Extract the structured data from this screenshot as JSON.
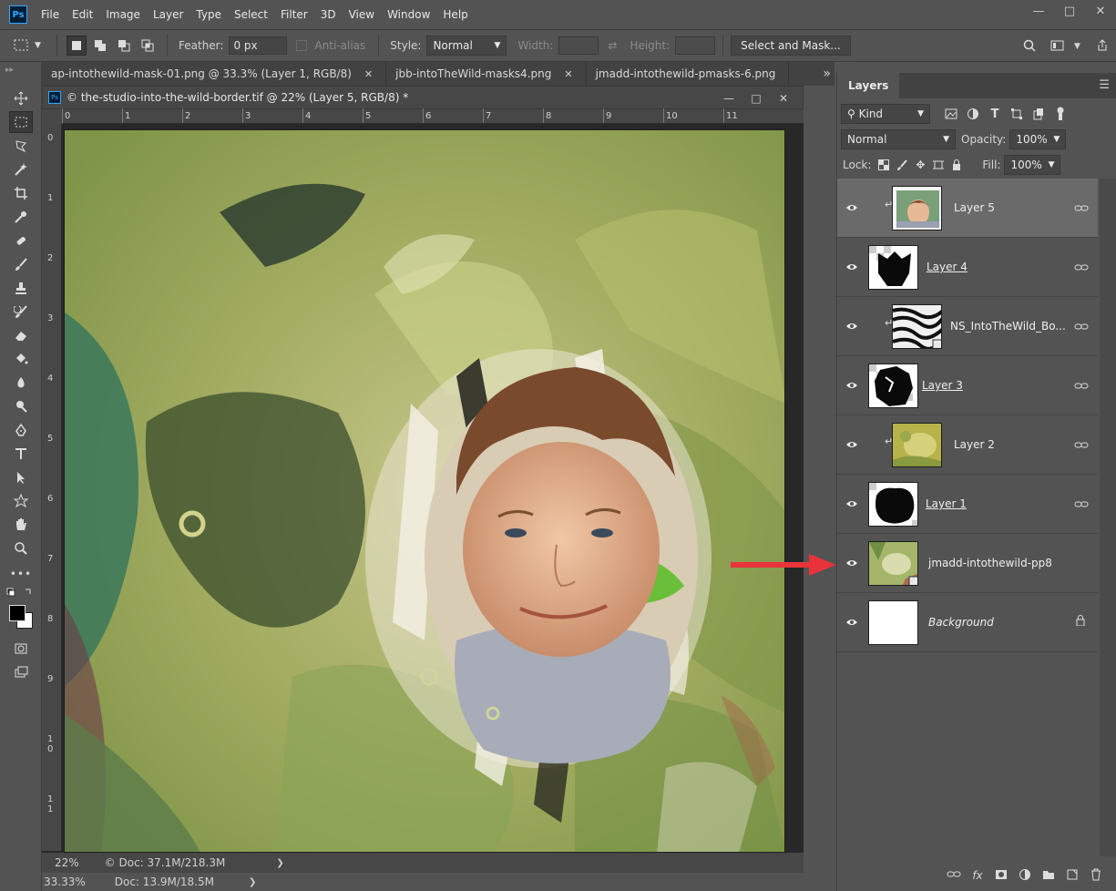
{
  "app": {
    "menu": [
      "File",
      "Edit",
      "Image",
      "Layer",
      "Type",
      "Select",
      "Filter",
      "3D",
      "View",
      "Window",
      "Help"
    ],
    "logo_text": "Ps"
  },
  "options": {
    "feather_label": "Feather:",
    "feather_value": "0 px",
    "antialias_label": "Anti-alias",
    "style_label": "Style:",
    "style_value": "Normal",
    "width_label": "Width:",
    "height_label": "Height:",
    "select_mask_label": "Select and Mask..."
  },
  "tabs": [
    {
      "label": "ap-intothewild-mask-01.png @ 33.3% (Layer 1, RGB/8)"
    },
    {
      "label": "jbb-intoTheWild-masks4.png"
    },
    {
      "label": "jmadd-intothewild-pmasks-6.png"
    }
  ],
  "document": {
    "title": "© the-studio-into-the-wild-border.tif @ 22% (Layer 5, RGB/8) *",
    "ruler_top": [
      "0",
      "1",
      "2",
      "3",
      "4",
      "5",
      "6",
      "7",
      "8",
      "9",
      "10",
      "11"
    ],
    "ruler_left": [
      "0",
      "1",
      "2",
      "3",
      "4",
      "5",
      "6",
      "7",
      "8",
      "9",
      "10",
      "11"
    ],
    "status_zoom": "22%",
    "status_doc": "© Doc: 37.1M/218.3M"
  },
  "app_status": {
    "zoom": "33.33%",
    "doc": "Doc: 13.9M/18.5M"
  },
  "layers_panel": {
    "title": "Layers",
    "filter_kind": "Kind",
    "blend_mode": "Normal",
    "opacity_label": "Opacity:",
    "opacity_value": "100%",
    "lock_label": "Lock:",
    "fill_label": "Fill:",
    "fill_value": "100%",
    "layers": [
      {
        "name": "Layer 5",
        "visible": true
      },
      {
        "name": "Layer 4",
        "visible": true
      },
      {
        "name": "NS_IntoTheWild_Bo...",
        "visible": true
      },
      {
        "name": "Layer 3",
        "visible": true
      },
      {
        "name": "Layer 2",
        "visible": true
      },
      {
        "name": "Layer 1",
        "visible": true
      },
      {
        "name": "jmadd-intothewild-pp8",
        "visible": true
      },
      {
        "name": "Background",
        "visible": true
      }
    ]
  },
  "colors": {
    "accent": "#31a8ff",
    "arrow": "#e8333a",
    "selected_row": "#6a6a6a"
  }
}
